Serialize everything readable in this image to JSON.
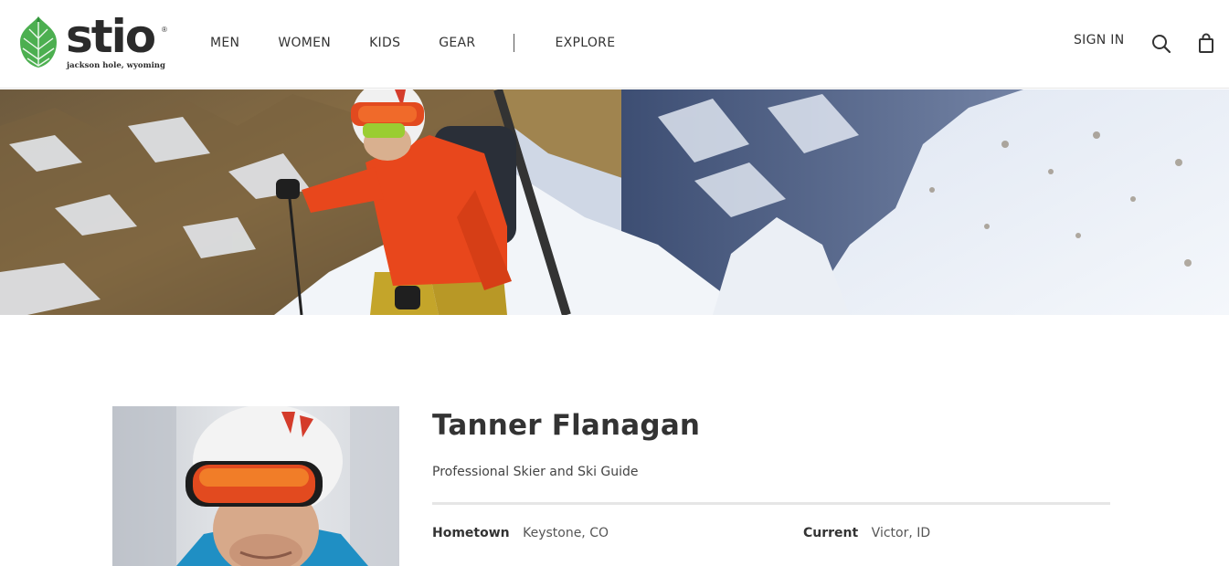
{
  "brand": {
    "name": "stio",
    "registered_mark": "®",
    "tagline": "jackson hole, wyoming",
    "colors": {
      "cone_green": "#4caf50",
      "cone_dark": "#2e8b3a",
      "wordmark": "#2b2b2b"
    }
  },
  "nav": {
    "items": [
      {
        "label": "MEN"
      },
      {
        "label": "WOMEN"
      },
      {
        "label": "KIDS"
      },
      {
        "label": "GEAR"
      },
      {
        "label": "EXPLORE"
      }
    ]
  },
  "account": {
    "sign_in_label": "SIGN IN",
    "search_icon": "search-icon",
    "bag_icon": "shopping-bag-icon"
  },
  "profile": {
    "name": "Tanner Flanagan",
    "title": "Professional Skier and Ski Guide",
    "hometown_label": "Hometown",
    "hometown_value": "Keystone, CO",
    "current_label": "Current",
    "current_value": "Victor, ID"
  },
  "colors": {
    "text": "#333333",
    "rule": "#e6e6e6",
    "jacket_orange": "#e8471c"
  }
}
